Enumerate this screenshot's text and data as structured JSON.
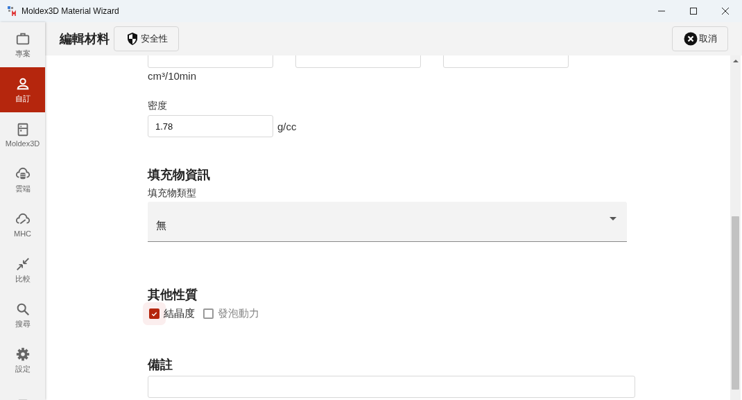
{
  "window": {
    "title": "Moldex3D Material Wizard"
  },
  "sidebar": {
    "items": [
      {
        "label": "專案",
        "selected": false
      },
      {
        "label": "自訂",
        "selected": true
      },
      {
        "label": "Moldex3D",
        "selected": false
      },
      {
        "label": "雲端",
        "selected": false
      },
      {
        "label": "MHC",
        "selected": false
      },
      {
        "label": "比較",
        "selected": false
      },
      {
        "label": "搜尋",
        "selected": false
      },
      {
        "label": "設定",
        "selected": false
      },
      {
        "selected": false
      }
    ]
  },
  "header": {
    "title": "編輯材料",
    "security_button": "安全性",
    "cancel_button": "取消"
  },
  "form": {
    "top_fields": [
      {
        "kind": "text"
      },
      {
        "kind": "text"
      },
      {
        "kind": "text"
      }
    ],
    "top_unit": "cm³/10min",
    "density": {
      "label": "密度",
      "value": "1.78",
      "unit": "g/cc"
    },
    "filler": {
      "heading": "填充物資訊",
      "label": "填充物類型",
      "value": "無"
    },
    "other": {
      "heading": "其他性質",
      "options": [
        {
          "label": "結晶度",
          "checked": true,
          "disabled": false
        },
        {
          "label": "發泡動力",
          "checked": false,
          "disabled": true
        }
      ]
    },
    "notes": {
      "heading": "備註"
    }
  }
}
